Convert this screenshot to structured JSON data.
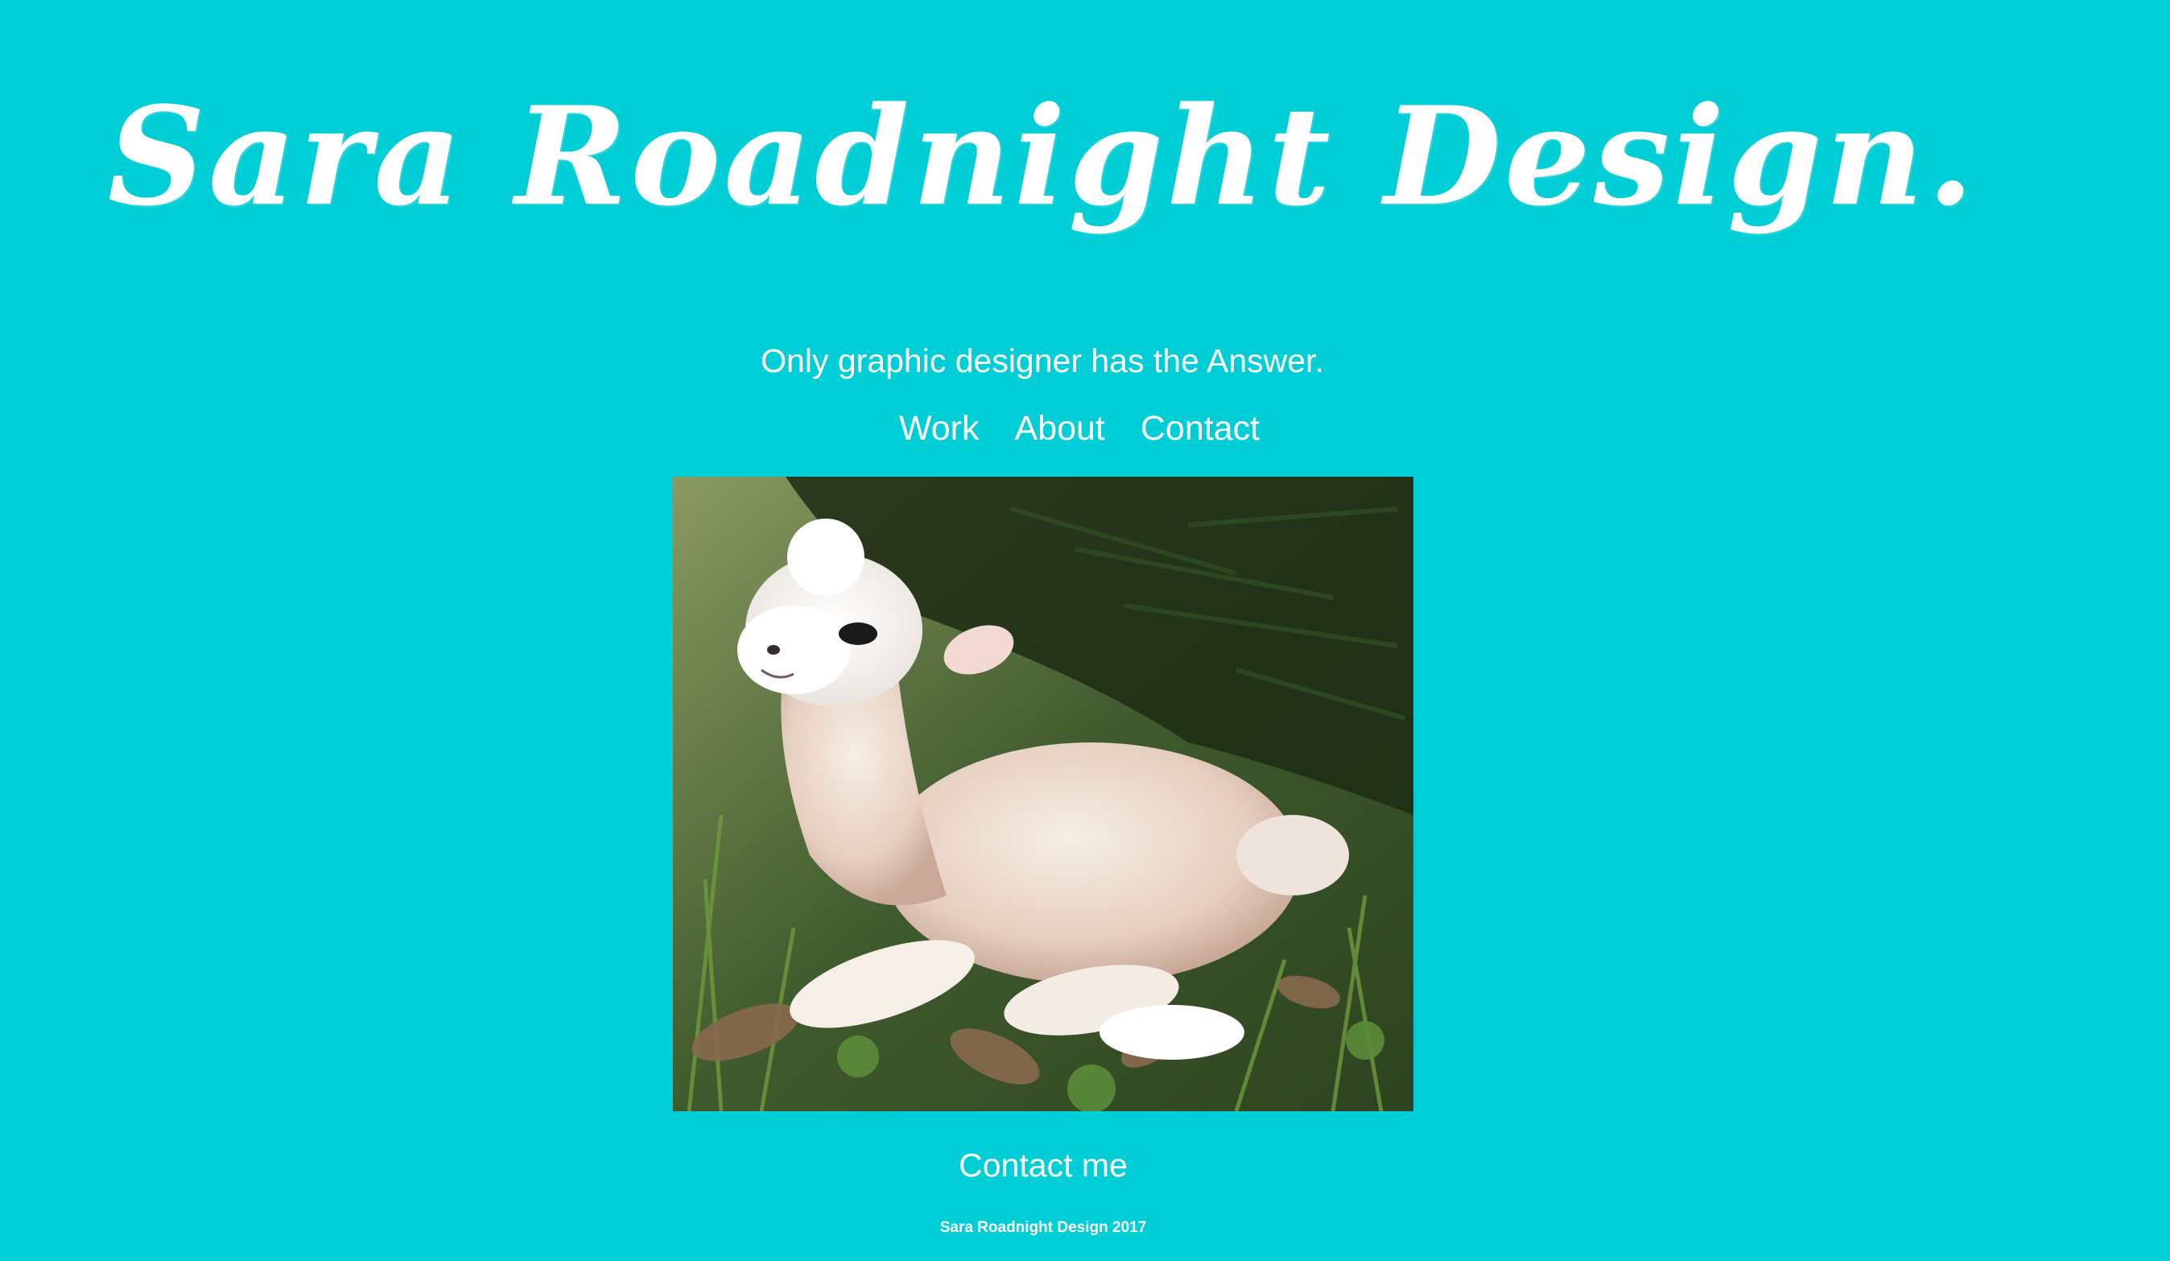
{
  "header": {
    "title": "Sara Roadnight Design.",
    "tagline": "Only graphic designer has the Answer."
  },
  "nav": {
    "items": [
      {
        "label": "Work"
      },
      {
        "label": "About"
      },
      {
        "label": "Contact"
      }
    ]
  },
  "hero": {
    "subject": "felted baby alpaca lying in grass under a fir tree"
  },
  "contact": {
    "label": "Contact me"
  },
  "footer": {
    "text": "Sara Roadnight Design 2017"
  },
  "colors": {
    "background": "#00ced6",
    "text": "#ffffff"
  }
}
